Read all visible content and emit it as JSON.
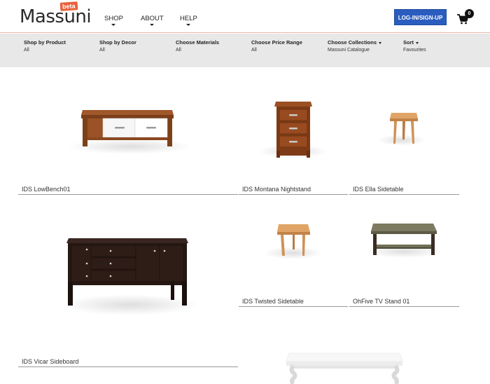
{
  "header": {
    "logo": "Massuni",
    "beta": "beta",
    "nav": [
      {
        "label": "SHOP"
      },
      {
        "label": "ABOUT"
      },
      {
        "label": "HELP"
      }
    ],
    "login_label": "LOG-IN/SIGN-UP",
    "cart_count": "0"
  },
  "filters": [
    {
      "label": "Shop by Product",
      "value": "All"
    },
    {
      "label": "Shop by Decor",
      "value": "All"
    },
    {
      "label": "Choose Materials",
      "value": "All"
    },
    {
      "label": "Choose Price Range",
      "value": "All"
    },
    {
      "label": "Choose Collections",
      "value": "Massuni Catalogue"
    },
    {
      "label": "Sort",
      "value": "Favourites"
    }
  ],
  "products": [
    {
      "name": "IDS LowBench01"
    },
    {
      "name": "IDS Montana Nightstand"
    },
    {
      "name": "IDS Ella Sidetable"
    },
    {
      "name": "IDS Vicar Sideboard"
    },
    {
      "name": "IDS Twisted Sidetable"
    },
    {
      "name": "OhFive TV Stand 01"
    }
  ],
  "colors": {
    "accent": "#2a5dbf",
    "beta": "#e8603c",
    "filter_bg": "#e8e8e8",
    "wood": "#8b4a22",
    "light_wood": "#d99a5a",
    "dark_wood": "#2c1c17"
  }
}
